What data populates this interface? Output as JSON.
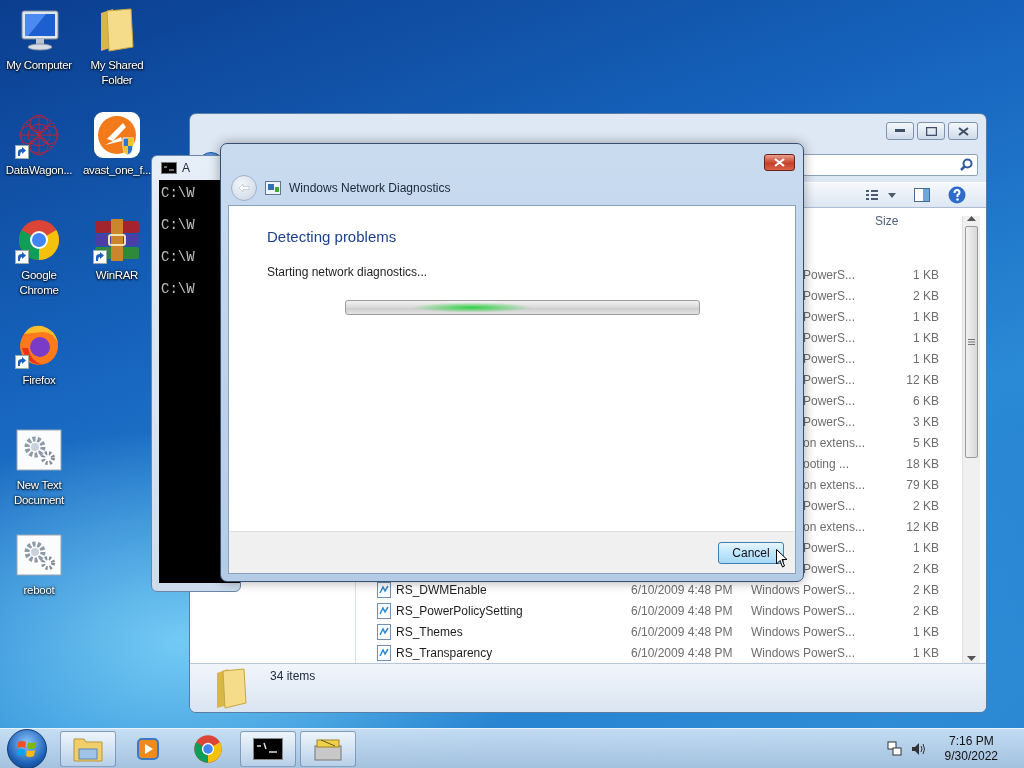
{
  "desktop_icons": [
    {
      "label": "My Computer",
      "kind": "computer",
      "shortcut": false
    },
    {
      "label": "DataWagon...",
      "kind": "mesh",
      "shortcut": true
    },
    {
      "label": "Google Chrome",
      "kind": "chrome",
      "shortcut": true
    },
    {
      "label": "Firefox",
      "kind": "firefox",
      "shortcut": true
    },
    {
      "label": "New Text Document",
      "kind": "gears",
      "shortcut": false
    },
    {
      "label": "reboot",
      "kind": "gears",
      "shortcut": false
    },
    {
      "label": "My Shared Folder",
      "kind": "folder",
      "shortcut": false
    },
    {
      "label": "avast_one_f...",
      "kind": "avast",
      "shortcut": false
    },
    {
      "label": "WinRAR",
      "kind": "books",
      "shortcut": true
    }
  ],
  "explorer": {
    "size_header": "Size",
    "rows": [
      {
        "kind": "partial",
        "type": "PowerS...",
        "size": "1 KB"
      },
      {
        "kind": "partial",
        "type": "PowerS...",
        "size": "2 KB"
      },
      {
        "kind": "partial",
        "type": "PowerS...",
        "size": "1 KB"
      },
      {
        "kind": "partial",
        "type": "PowerS...",
        "size": "1 KB"
      },
      {
        "kind": "partial",
        "type": "PowerS...",
        "size": "1 KB"
      },
      {
        "kind": "partial",
        "type": "PowerS...",
        "size": "12 KB"
      },
      {
        "kind": "partial",
        "type": "PowerS...",
        "size": "6 KB"
      },
      {
        "kind": "partial",
        "type": "PowerS...",
        "size": "3 KB"
      },
      {
        "kind": "partial",
        "type": "on extens...",
        "size": "5 KB"
      },
      {
        "kind": "partial",
        "type": "ooting ...",
        "size": "18 KB"
      },
      {
        "kind": "partial",
        "type": "on extens...",
        "size": "79 KB"
      },
      {
        "kind": "partial",
        "type": "PowerS...",
        "size": "2 KB"
      },
      {
        "kind": "partial",
        "type": "on extens...",
        "size": "12 KB"
      },
      {
        "kind": "partial",
        "type": "PowerS...",
        "size": "1 KB"
      },
      {
        "kind": "partial",
        "type": "PowerS...",
        "size": "2 KB"
      },
      {
        "kind": "full",
        "name": "RS_DWMEnable",
        "date": "6/10/2009 4:48 PM",
        "type": "Windows PowerS...",
        "size": "2 KB"
      },
      {
        "kind": "full",
        "name": "RS_PowerPolicySetting",
        "date": "6/10/2009 4:48 PM",
        "type": "Windows PowerS...",
        "size": "2 KB"
      },
      {
        "kind": "full",
        "name": "RS_Themes",
        "date": "6/10/2009 4:48 PM",
        "type": "Windows PowerS...",
        "size": "1 KB"
      },
      {
        "kind": "full",
        "name": "RS_Transparency",
        "date": "6/10/2009 4:48 PM",
        "type": "Windows PowerS...",
        "size": "1 KB"
      }
    ],
    "status": "34 items"
  },
  "cmd_window": {
    "title": "A",
    "lines": [
      "C:\\W",
      "C:\\W",
      "C:\\W",
      "C:\\W"
    ]
  },
  "dialog": {
    "title": "Windows Network Diagnostics",
    "heading": "Detecting problems",
    "message": "Starting network diagnostics...",
    "cancel": "Cancel"
  },
  "taskbar": {
    "items": [
      {
        "kind": "explorer",
        "running": true
      },
      {
        "kind": "media",
        "running": false
      },
      {
        "kind": "chrome",
        "running": false
      },
      {
        "kind": "console",
        "running": true
      },
      {
        "kind": "tool",
        "running": true
      }
    ],
    "time": "7:16 PM",
    "date": "9/30/2022"
  }
}
